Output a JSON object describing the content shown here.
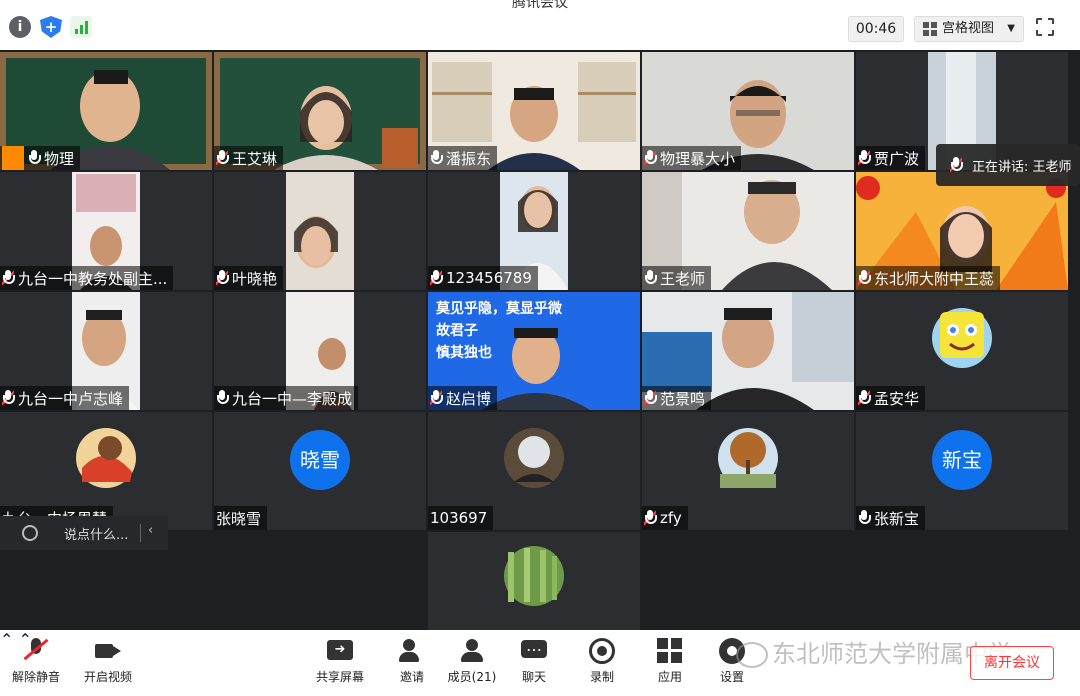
{
  "window": {
    "title": "腾讯会议"
  },
  "topbar": {
    "timer": "00:46",
    "view_label": "宫格视图"
  },
  "speaking": {
    "label": "正在讲话: 王老师"
  },
  "tiles": [
    {
      "name": "物理",
      "muted": false
    },
    {
      "name": "王艾琳",
      "muted": true
    },
    {
      "name": "潘振东",
      "muted": false
    },
    {
      "name": "物理暴大小",
      "muted": true
    },
    {
      "name": "贾广波",
      "muted": true
    },
    {
      "name": "九台一中教务处副主...",
      "muted": true
    },
    {
      "name": "叶晓艳",
      "muted": true
    },
    {
      "name": "123456789",
      "muted": true
    },
    {
      "name": "王老师",
      "muted": false
    },
    {
      "name": "东北师大附中王蕊",
      "muted": true
    },
    {
      "name": "九台一中卢志峰",
      "muted": true
    },
    {
      "name": "九台一中—李殿成",
      "muted": false
    },
    {
      "name": "赵启博",
      "muted": true
    },
    {
      "name": "范景鸣",
      "muted": true
    },
    {
      "name": "孟安华",
      "muted": true
    },
    {
      "name": "九台一中杨恩慧",
      "muted": false
    },
    {
      "name": "张晓雪",
      "muted": false
    },
    {
      "name": "103697",
      "muted": false
    },
    {
      "name": "zfy",
      "muted": true
    },
    {
      "name": "张新宝",
      "muted": false
    }
  ],
  "avatars": {
    "xiaoxue": "晓雪",
    "xinbao": "新宝"
  },
  "banner": {
    "line1": "莫见乎隐，莫显乎微",
    "line2": "故君子",
    "line3": "慎其独也"
  },
  "chat": {
    "placeholder": "说点什么..."
  },
  "toolbar": {
    "unmute": "解除静音",
    "video": "开启视频",
    "share": "共享屏幕",
    "invite": "邀请",
    "members": "成员(21)",
    "chat": "聊天",
    "record": "录制",
    "apps": "应用",
    "settings": "设置",
    "leave": "离开会议"
  },
  "watermark": {
    "text": "东北师范大学附属中学"
  },
  "colors": {
    "accent": "#0e72ed",
    "active": "#3ac84b",
    "danger": "#ff3333"
  }
}
